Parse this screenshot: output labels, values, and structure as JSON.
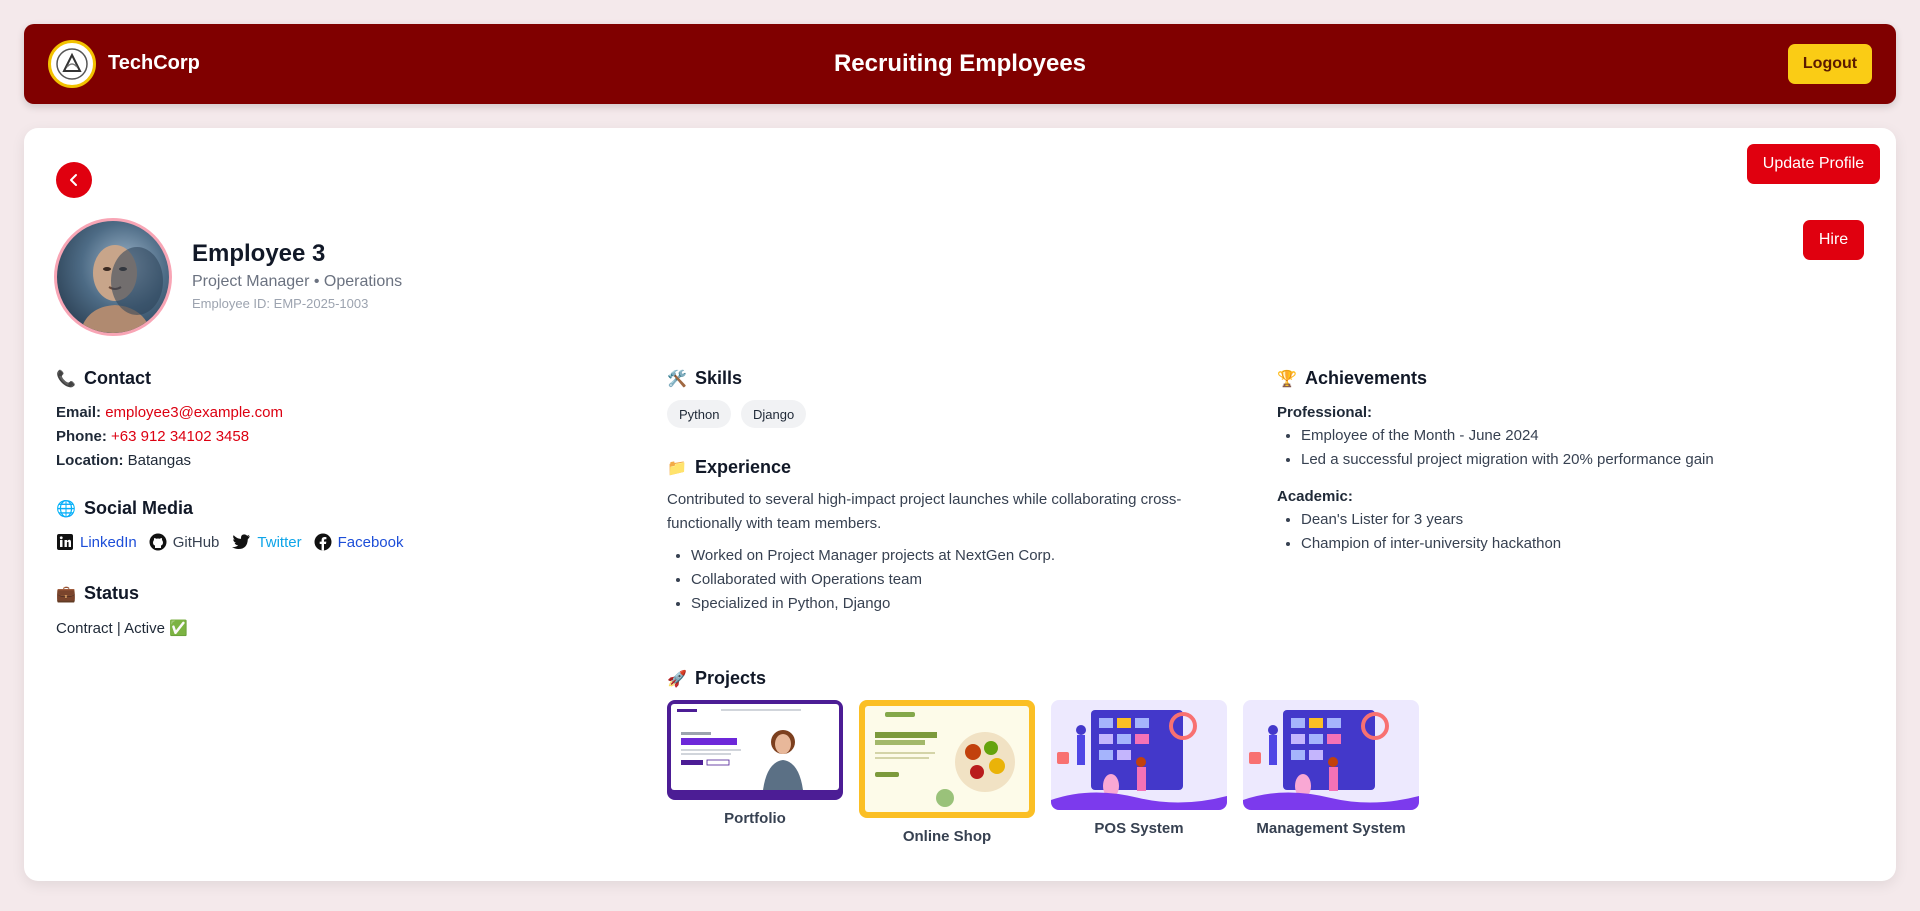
{
  "header": {
    "brand": "TechCorp",
    "title": "Recruiting Employees",
    "logout_label": "Logout"
  },
  "actions": {
    "update_profile_label": "Update Profile",
    "hire_label": "Hire"
  },
  "employee": {
    "name": "Employee 3",
    "role": "Project Manager • Operations",
    "id_text": "Employee ID: EMP-2025-1003"
  },
  "contact": {
    "title": "Contact",
    "email_label": "Email:",
    "email": "employee3@example.com",
    "phone_label": "Phone:",
    "phone": "+63 912 34102 3458",
    "location_label": "Location:",
    "location": "Batangas"
  },
  "social": {
    "title": "Social Media",
    "links": [
      {
        "label": "LinkedIn",
        "icon": "linkedin-icon"
      },
      {
        "label": "GitHub",
        "icon": "github-icon"
      },
      {
        "label": "Twitter",
        "icon": "twitter-icon"
      },
      {
        "label": "Facebook",
        "icon": "facebook-icon"
      }
    ]
  },
  "status": {
    "title": "Status",
    "text": "Contract | Active ✅"
  },
  "skills": {
    "title": "Skills",
    "items": [
      "Python",
      "Django"
    ]
  },
  "experience": {
    "title": "Experience",
    "summary": "Contributed to several high-impact project launches while collaborating cross-functionally with team members.",
    "bullets": [
      "Worked on Project Manager projects at NextGen Corp.",
      "Collaborated with Operations team",
      "Specialized in Python, Django"
    ]
  },
  "achievements": {
    "title": "Achievements",
    "professional_label": "Professional:",
    "professional": [
      "Employee of the Month - June 2024",
      "Led a successful project migration with 20% performance gain"
    ],
    "academic_label": "Academic:",
    "academic": [
      "Dean's Lister for 3 years",
      "Champion of inter-university hackathon"
    ]
  },
  "projects": {
    "title": "Projects",
    "items": [
      {
        "label": "Portfolio"
      },
      {
        "label": "Online Shop"
      },
      {
        "label": "POS System"
      },
      {
        "label": "Management System"
      }
    ]
  },
  "colors": {
    "header_bg": "#800000",
    "accent_red": "#e0000f",
    "logout_yellow": "#facc15",
    "page_bg": "#f4e9eb"
  }
}
